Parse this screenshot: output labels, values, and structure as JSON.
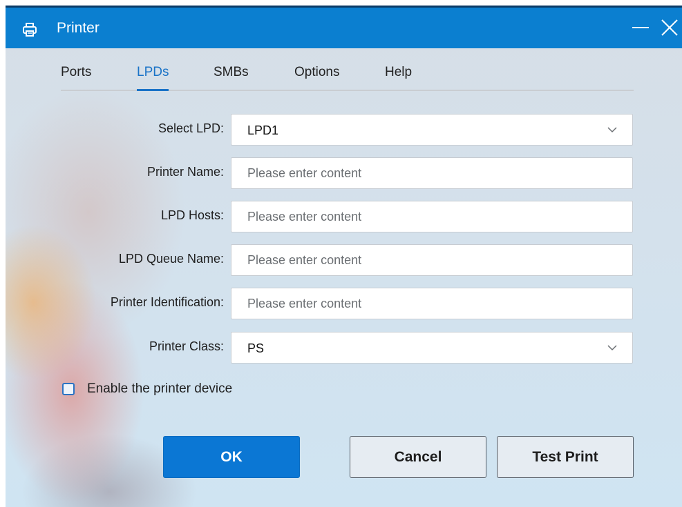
{
  "window": {
    "title": "Printer",
    "icon": "printer-icon",
    "accent": "#0b7fd0"
  },
  "tabs": [
    {
      "label": "Ports",
      "active": false
    },
    {
      "label": "LPDs",
      "active": true
    },
    {
      "label": "SMBs",
      "active": false
    },
    {
      "label": "Options",
      "active": false
    },
    {
      "label": "Help",
      "active": false
    }
  ],
  "form": {
    "select_lpd": {
      "label": "Select LPD:",
      "value": "LPD1"
    },
    "printer_name": {
      "label": "Printer Name:",
      "value": "",
      "placeholder": "Please enter content"
    },
    "lpd_hosts": {
      "label": "LPD Hosts:",
      "value": "",
      "placeholder": "Please enter content"
    },
    "lpd_queue_name": {
      "label": "LPD Queue Name:",
      "value": "",
      "placeholder": "Please enter content"
    },
    "printer_identification": {
      "label": "Printer Identification:",
      "value": "",
      "placeholder": "Please enter content"
    },
    "printer_class": {
      "label": "Printer Class:",
      "value": "PS"
    }
  },
  "enable_device": {
    "label": "Enable the printer device",
    "checked": false
  },
  "buttons": {
    "ok": "OK",
    "cancel": "Cancel",
    "test_print": "Test Print"
  }
}
